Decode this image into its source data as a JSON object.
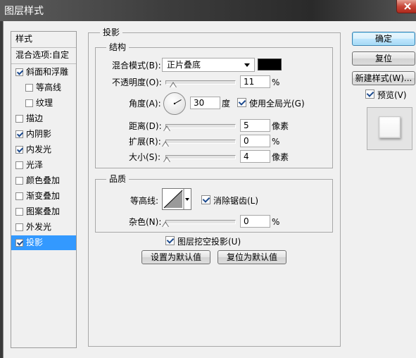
{
  "window": {
    "title": "图层样式"
  },
  "sidebar": {
    "header": "样式",
    "blend_options": "混合选项:自定",
    "items": [
      {
        "label": "斜面和浮雕",
        "checked": true
      },
      {
        "label": "等高线",
        "checked": false
      },
      {
        "label": "纹理",
        "checked": false
      },
      {
        "label": "描边",
        "checked": false
      },
      {
        "label": "内阴影",
        "checked": true
      },
      {
        "label": "内发光",
        "checked": true
      },
      {
        "label": "光泽",
        "checked": false
      },
      {
        "label": "颜色叠加",
        "checked": false
      },
      {
        "label": "渐变叠加",
        "checked": false
      },
      {
        "label": "图案叠加",
        "checked": false
      },
      {
        "label": "外发光",
        "checked": false
      },
      {
        "label": "投影",
        "checked": true
      }
    ],
    "selected_index": 11
  },
  "drop_shadow": {
    "group_title": "投影",
    "structure": {
      "title": "结构",
      "blend_mode_label": "混合模式(B):",
      "blend_mode_value": "正片叠底",
      "shadow_color": "#000000",
      "opacity_label": "不透明度(O):",
      "opacity_value": "11",
      "opacity_unit": "%",
      "opacity_fraction": 0.11,
      "angle_label": "角度(A):",
      "angle_value": "30",
      "angle_unit": "度",
      "global_light_label": "使用全局光(G)",
      "global_light_checked": true,
      "distance_label": "距离(D):",
      "distance_value": "5",
      "distance_unit": "像素",
      "distance_fraction": 0.02,
      "spread_label": "扩展(R):",
      "spread_value": "0",
      "spread_unit": "%",
      "spread_fraction": 0,
      "size_label": "大小(S):",
      "size_value": "4",
      "size_unit": "像素",
      "size_fraction": 0.02
    },
    "quality": {
      "title": "品质",
      "contour_label": "等高线:",
      "antialias_label": "消除锯齿(L)",
      "antialias_checked": true,
      "noise_label": "杂色(N):",
      "noise_value": "0",
      "noise_unit": "%",
      "noise_fraction": 0
    },
    "knockout_label": "图层挖空投影(U)",
    "knockout_checked": true,
    "make_default_label": "设置为默认值",
    "reset_default_label": "复位为默认值"
  },
  "actions": {
    "ok_label": "确定",
    "reset_label": "复位",
    "new_style_label": "新建样式(W)...",
    "preview_label": "预览(V)",
    "preview_checked": true
  },
  "icons": [
    "close-icon",
    "dropdown-arrow-icon",
    "angle-dial-icon",
    "contour-curve-icon",
    "checkmark-icon"
  ]
}
